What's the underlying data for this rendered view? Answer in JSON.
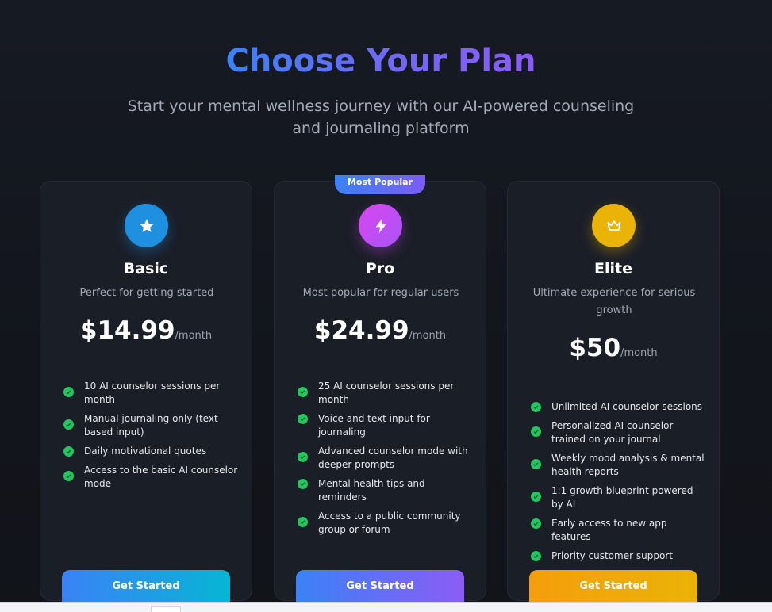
{
  "header": {
    "title": "Choose Your Plan",
    "subtitle": "Start your mental wellness journey with our AI-powered counseling and journaling platform"
  },
  "plans": [
    {
      "name": "Basic",
      "description": "Perfect for getting started",
      "price": "$14.99",
      "period": "/month",
      "icon": "star-icon",
      "features": [
        "10 AI counselor sessions per month",
        "Manual journaling only (text-based input)",
        "Daily motivational quotes",
        "Access to the basic AI counselor mode"
      ],
      "cta": "Get Started"
    },
    {
      "name": "Pro",
      "badge": "Most Popular",
      "description": "Most popular for regular users",
      "price": "$24.99",
      "period": "/month",
      "icon": "lightning-icon",
      "features": [
        "25 AI counselor sessions per month",
        "Voice and text input for journaling",
        "Advanced counselor mode with deeper prompts",
        "Mental health tips and reminders",
        "Access to a public community group or forum"
      ],
      "cta": "Get Started"
    },
    {
      "name": "Elite",
      "description": "Ultimate experience for serious growth",
      "price": "$50",
      "period": "/month",
      "icon": "crown-icon",
      "features": [
        "Unlimited AI counselor sessions",
        "Personalized AI counselor trained on your journal",
        "Weekly mood analysis & mental health reports",
        "1:1 growth blueprint powered by AI",
        "Early access to new app features",
        "Priority customer support"
      ],
      "cta": "Get Started"
    }
  ],
  "colors": {
    "background": "#12151c",
    "card": "#1a1e27",
    "check": "#22c55e",
    "basic_accent": "#1f8fe0",
    "pro_accent": "#a855f7",
    "elite_accent": "#eab308"
  }
}
